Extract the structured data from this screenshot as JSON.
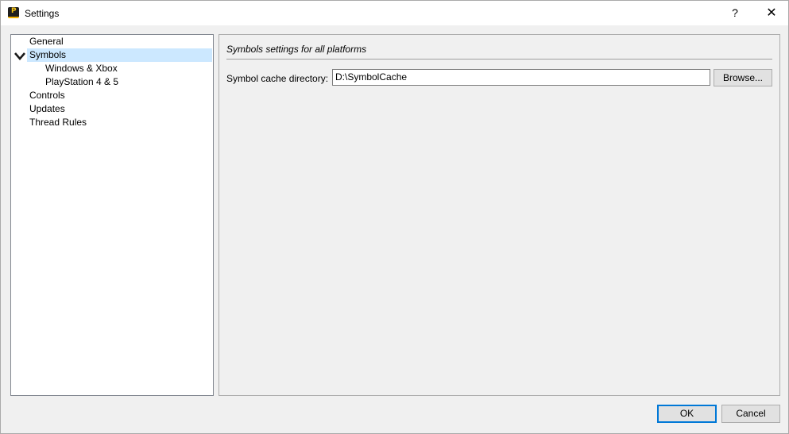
{
  "window": {
    "title": "Settings",
    "app_icon_letter": "P",
    "help_label": "?",
    "close_label": "✕"
  },
  "tree": {
    "items": [
      {
        "label": "General",
        "level": 0,
        "selected": false
      },
      {
        "label": "Symbols",
        "level": 0,
        "selected": true,
        "expanded": true
      },
      {
        "label": "Windows & Xbox",
        "level": 1,
        "selected": false
      },
      {
        "label": "PlayStation 4 & 5",
        "level": 1,
        "selected": false
      },
      {
        "label": "Controls",
        "level": 0,
        "selected": false
      },
      {
        "label": "Updates",
        "level": 0,
        "selected": false
      },
      {
        "label": "Thread Rules",
        "level": 0,
        "selected": false
      }
    ]
  },
  "content": {
    "section_title": "Symbols settings for all platforms",
    "symbol_cache_label": "Symbol cache directory:",
    "symbol_cache_value": "D:\\SymbolCache",
    "browse_label": "Browse..."
  },
  "footer": {
    "ok_label": "OK",
    "cancel_label": "Cancel"
  },
  "colors": {
    "selection": "#cce8ff",
    "default_button_border": "#0078d7"
  }
}
